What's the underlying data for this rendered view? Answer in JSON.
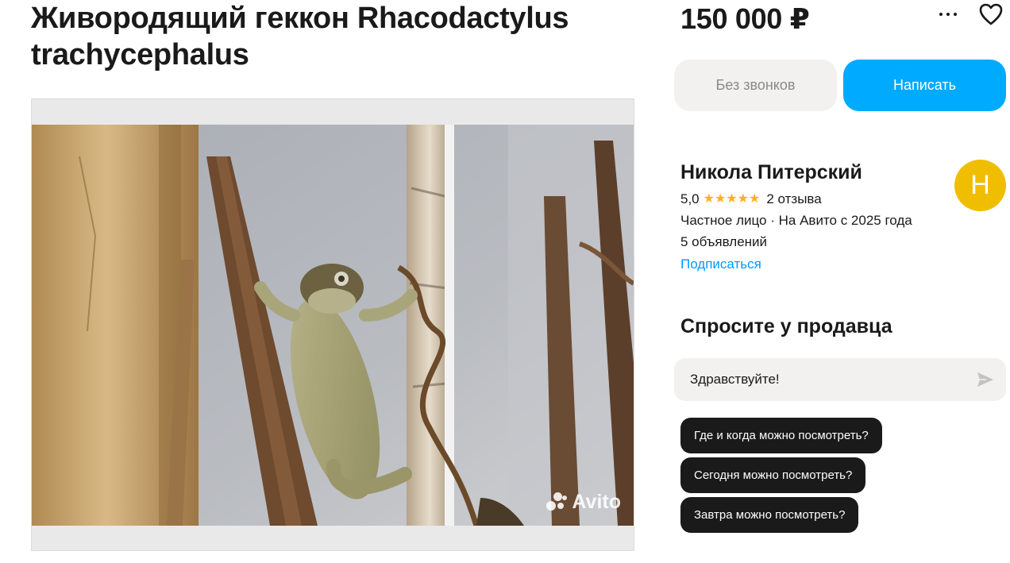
{
  "listing": {
    "title": "Живородящий геккон Rhacodactylus trachycephalus",
    "price": "150 000 ₽",
    "photo_watermark": "Avito"
  },
  "actions": {
    "more_icon": "more-horizontal-icon",
    "favorite_icon": "heart-icon",
    "no_calls_label": "Без звонков",
    "write_label": "Написать"
  },
  "seller": {
    "name": "Никола Питерский",
    "avatar_letter": "Н",
    "rating": "5,0",
    "stars": "★★★★★",
    "reviews": "2 отзыва",
    "meta": "Частное лицо · На Авито с 2025 года",
    "ads_count": "5 объявлений",
    "subscribe_label": "Подписаться"
  },
  "ask": {
    "title": "Спросите у продавца",
    "message_value": "Здравствуйте!",
    "send_icon": "send-icon",
    "quick_questions": [
      "Где и когда можно посмотреть?",
      "Сегодня можно посмотреть?",
      "Завтра можно посмотреть?"
    ]
  },
  "colors": {
    "accent": "#00aaff",
    "avatar": "#f0be00",
    "star": "#ffb021",
    "link": "#0099ff",
    "chip": "#1a1a1a"
  }
}
